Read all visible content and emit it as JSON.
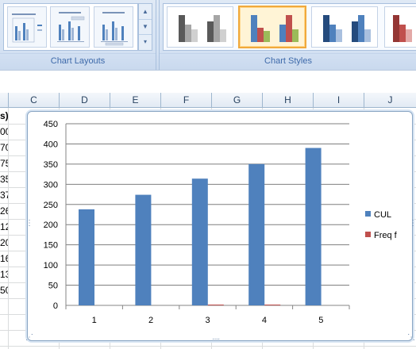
{
  "ribbon": {
    "chart_layouts_label": "Chart Layouts",
    "chart_styles_label": "Chart Styles"
  },
  "grid": {
    "columns": [
      "C",
      "D",
      "E",
      "F",
      "G",
      "H",
      "I",
      "J"
    ],
    "column_b_cells": [
      "s)",
      "00",
      "70",
      "75",
      "35",
      "37",
      "26",
      "12",
      "20",
      "16",
      "13",
      "50"
    ]
  },
  "colors": {
    "series_cul": "#4f81bd",
    "series_freqf": "#c0504d",
    "style_gray_dark": "#595959",
    "style_gray_light": "#a6a6a6",
    "style_green": "#9bbb59",
    "selected_border": "#f0a93c"
  },
  "icons": {
    "gallery_up": "up-arrow-icon",
    "gallery_down": "down-arrow-icon",
    "gallery_more": "more-icon"
  },
  "chart_data": {
    "type": "bar",
    "categories": [
      "1",
      "2",
      "3",
      "4",
      "5"
    ],
    "series": [
      {
        "name": "CUL",
        "values": [
          238,
          274,
          314,
          350,
          390
        ]
      },
      {
        "name": "Freq f",
        "values": [
          0,
          0,
          2,
          2,
          0
        ]
      }
    ],
    "ylim": [
      0,
      450
    ],
    "yticks": [
      "0",
      "50",
      "100",
      "150",
      "200",
      "250",
      "300",
      "350",
      "400",
      "450"
    ],
    "grid": true,
    "legend": "right"
  }
}
